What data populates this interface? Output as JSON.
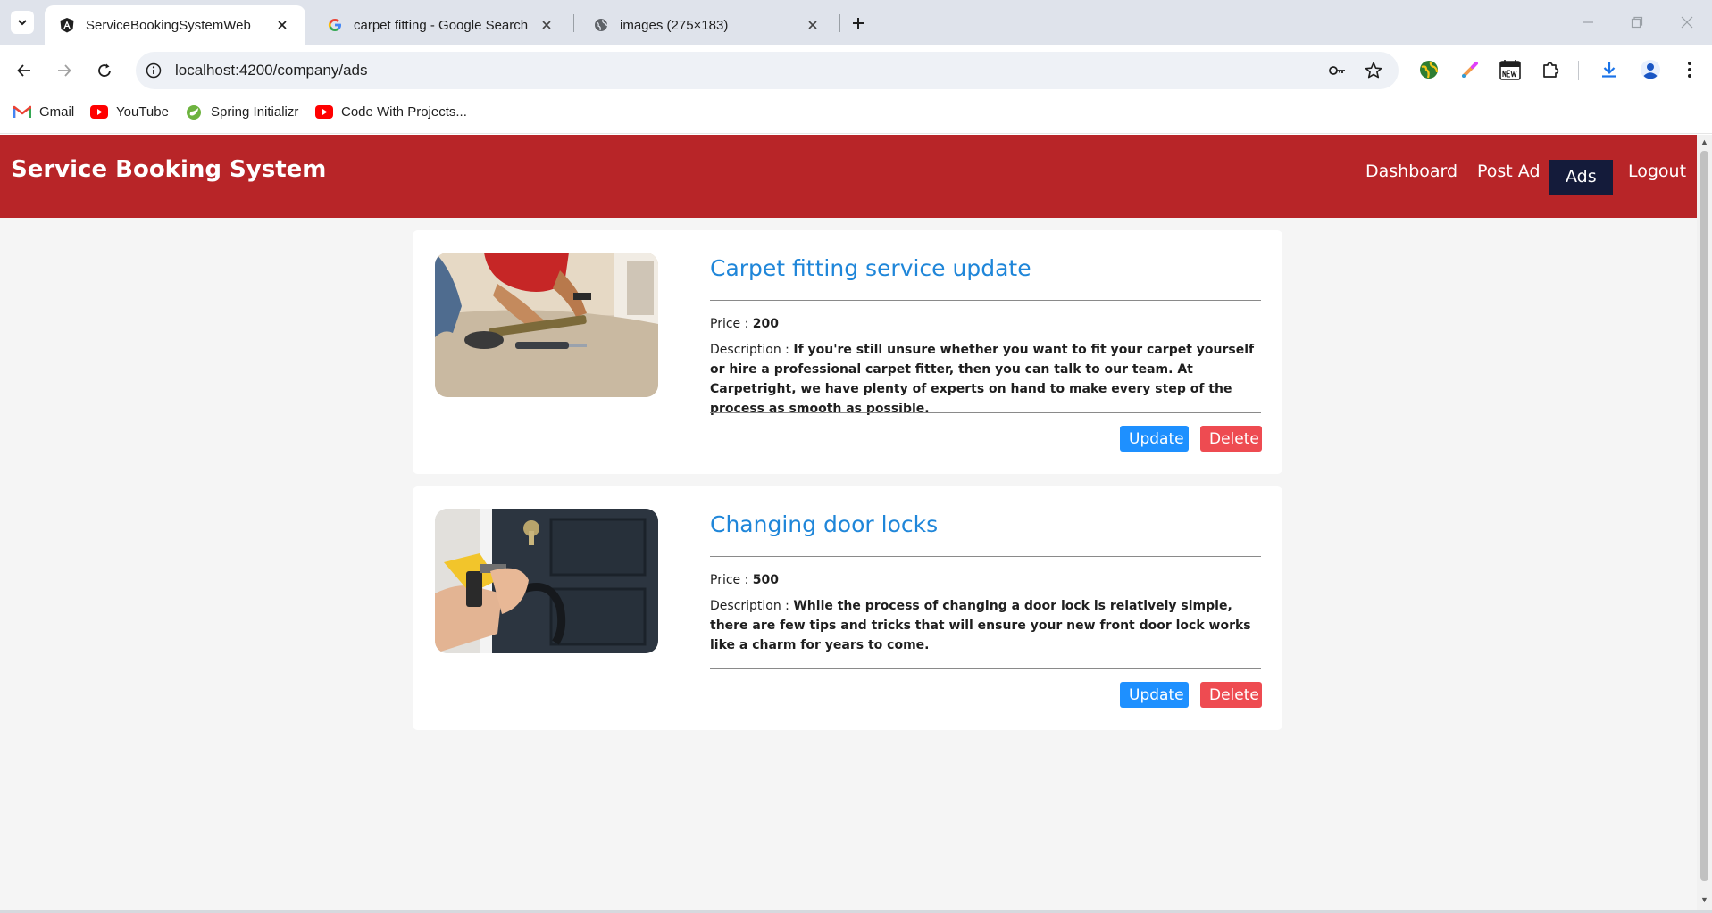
{
  "browser": {
    "tabs": [
      {
        "title": "ServiceBookingSystemWeb",
        "icon": "angular-icon",
        "active": true
      },
      {
        "title": "carpet fitting - Google Search",
        "icon": "google-icon",
        "active": false
      },
      {
        "title": "images (275×183)",
        "icon": "globe-icon",
        "active": false
      }
    ],
    "url": "localhost:4200/company/ads",
    "bookmarks": [
      {
        "label": "Gmail",
        "icon": "gmail-icon"
      },
      {
        "label": "YouTube",
        "icon": "youtube-icon"
      },
      {
        "label": "Spring Initializr",
        "icon": "spring-icon"
      },
      {
        "label": "Code With Projects...",
        "icon": "youtube-icon"
      }
    ]
  },
  "app": {
    "brand": "Service Booking System",
    "nav": [
      {
        "label": "Dashboard",
        "active": false
      },
      {
        "label": "Post Ad",
        "active": false
      },
      {
        "label": "Ads",
        "active": true
      },
      {
        "label": "Logout",
        "active": false
      }
    ],
    "colors": {
      "header": "#b82528",
      "active_nav": "#141b3a",
      "title": "#1f86d9",
      "update": "#1e90ff",
      "delete": "#ee4b51"
    }
  },
  "ads": [
    {
      "title": "Carpet fitting service update",
      "price_label": "Price :",
      "price": "200",
      "description_label": "Description :",
      "description": "If you're still unsure whether you want to fit your carpet yourself or hire a professional carpet fitter, then you can talk to our team. At Carpetright, we have plenty of experts on hand to make every step of the process as smooth as possible.",
      "update_label": "Update",
      "delete_label": "Delete"
    },
    {
      "title": "Changing door locks",
      "price_label": "Price :",
      "price": "500",
      "description_label": "Description :",
      "description": "While the process of changing a door lock is relatively simple, there are few tips and tricks that will ensure your new front door lock works like a charm for years to come.",
      "update_label": "Update",
      "delete_label": "Delete"
    }
  ]
}
